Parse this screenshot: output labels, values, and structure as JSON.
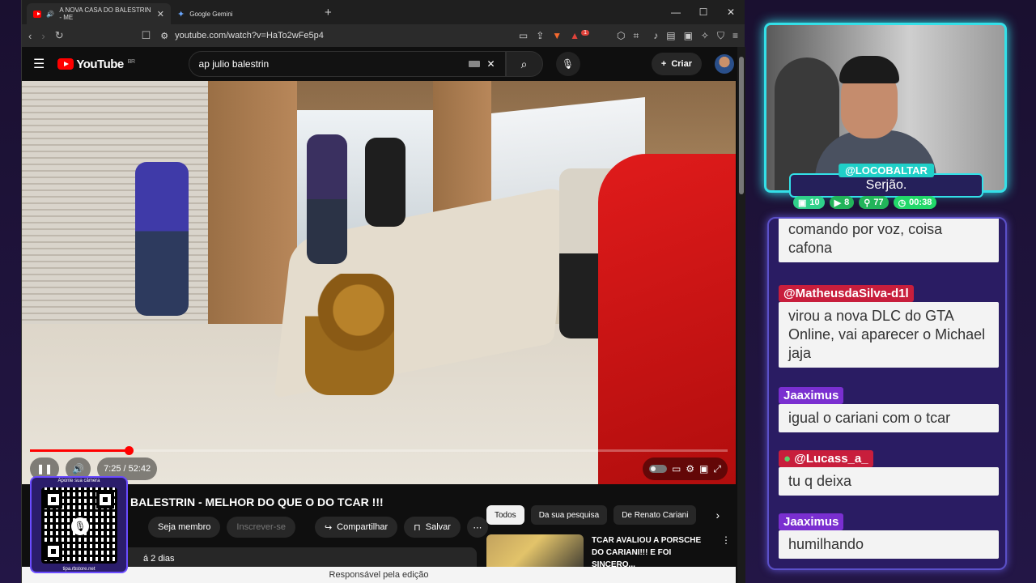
{
  "browser": {
    "tabs": [
      {
        "label": "A NOVA CASA DO BALESTRIN - ME",
        "active": true
      },
      {
        "label": "Google Gemini",
        "active": false
      }
    ],
    "url": "youtube.com/watch?v=HaTo2wFe5p4",
    "extension_badge": "1"
  },
  "youtube": {
    "logo_text": "YouTube",
    "region": "BR",
    "search_value": "ap julio balestrin",
    "create_label": "Criar",
    "player": {
      "current_time": "7:25",
      "duration": "52:42",
      "time_display": "7:25 / 52:42",
      "progress_fraction": 0.141
    },
    "video_title": "BALESTRIN - MELHOR DO QUE O DO TCAR !!!",
    "actions": {
      "join": "Seja membro",
      "subscribe": "Inscrever-se",
      "share": "Compartilhar",
      "save": "Salvar"
    },
    "description_snippet": "á 2 dias",
    "chips": [
      "Todos",
      "Da sua pesquisa",
      "De Renato Cariani"
    ],
    "recommendation": {
      "title": "TCAR AVALIOU A PORSCHE DO CARIANI!!! E FOI SINCERO..."
    },
    "footer": "Responsável pela edição"
  },
  "qr": {
    "top_text": "Aponte sua câmera",
    "bottom_text": "tipa.rbstore.net"
  },
  "stream": {
    "handle": "@LOCOBALTAR",
    "name": "Serjão.",
    "stats": [
      {
        "icon": "twitch-icon",
        "value": "10"
      },
      {
        "icon": "youtube-icon",
        "value": "8"
      },
      {
        "icon": "kick-icon",
        "value": "77"
      },
      {
        "icon": "clock-icon",
        "value": "00:38"
      }
    ],
    "colors": {
      "accent": "#33e0e8",
      "chat_border": "#5b50c8",
      "user_tag": "#7a2fd0"
    }
  },
  "chat": [
    {
      "user": "",
      "text": "comando por voz, coisa cafona",
      "tag_color": ""
    },
    {
      "user": "@MatheusdaSilva-d1l",
      "text": "virou a nova DLC do GTA Online, vai aparecer o Michael jaja",
      "tag_color": "#c81e3c"
    },
    {
      "user": "Jaaximus",
      "text": "igual o cariani com o tcar",
      "tag_color": "#7a2fd0"
    },
    {
      "user": "@Lucass_a_",
      "text": "tu q deixa",
      "tag_color": "#c81e3c"
    },
    {
      "user": "Jaaximus",
      "text": "humilhando",
      "tag_color": "#7a2fd0"
    }
  ]
}
